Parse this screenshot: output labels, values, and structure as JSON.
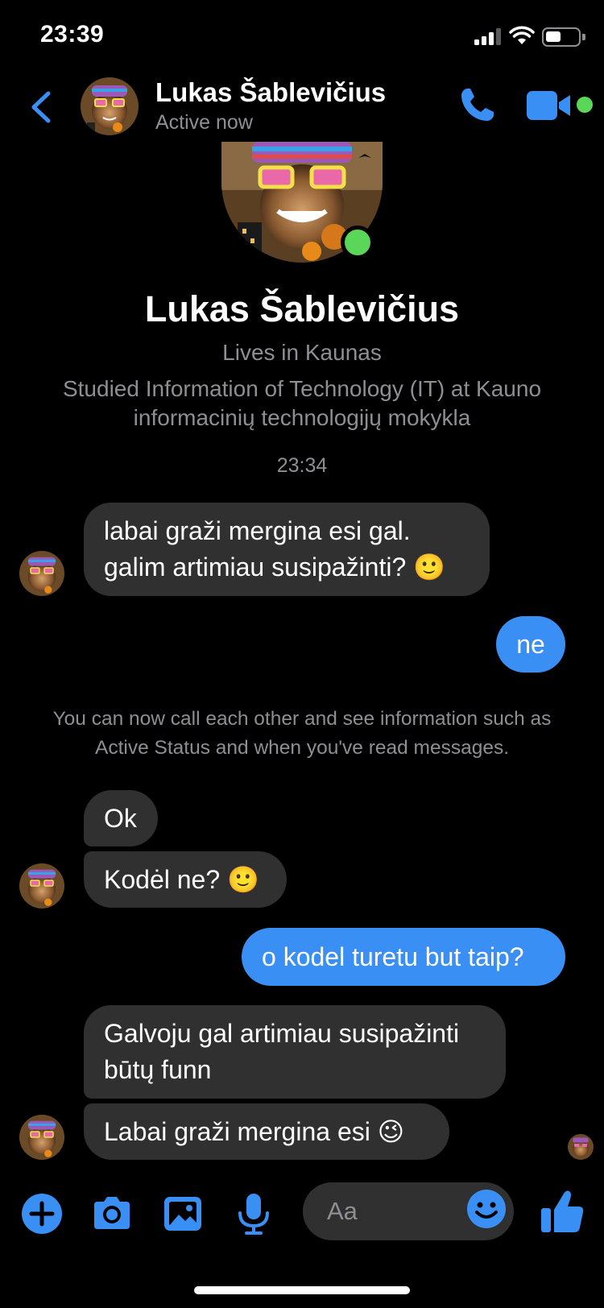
{
  "status_bar": {
    "time": "23:39"
  },
  "header": {
    "contact_name": "Lukas Šablevičius",
    "status": "Active now"
  },
  "profile": {
    "name": "Lukas Šablevičius",
    "lives": "Lives in Kaunas",
    "studied": "Studied Information of Technology (IT) at Kauno informacinių technologijų mokykla"
  },
  "conversation": {
    "timestamp": "23:34",
    "messages": [
      {
        "from": "contact",
        "text": "labai graži mergina esi gal. galim artimiau susipažinti? 🙂"
      },
      {
        "from": "me",
        "text": "ne"
      },
      {
        "from": "system",
        "text": "You can now call each other and see information such as Active Status and when you've read messages."
      },
      {
        "from": "contact",
        "text": "Ok"
      },
      {
        "from": "contact",
        "text": "Kodėl ne? 🙂"
      },
      {
        "from": "me",
        "text": "o kodel turetu but taip?"
      },
      {
        "from": "contact",
        "text": "Galvoju gal artimiau susipažinti būtų funn"
      },
      {
        "from": "contact",
        "text": "Labai graži mergina esi 😉"
      }
    ]
  },
  "composer": {
    "placeholder": "Aa",
    "buttons": [
      "plus-icon",
      "camera-icon",
      "photo-icon",
      "microphone-icon",
      "emoji-icon",
      "thumbs-up-icon"
    ]
  },
  "colors": {
    "accent": "#3a8ff4",
    "incoming_bubble": "#303030",
    "online": "#5ad658",
    "secondary_text": "#8e8e93"
  }
}
